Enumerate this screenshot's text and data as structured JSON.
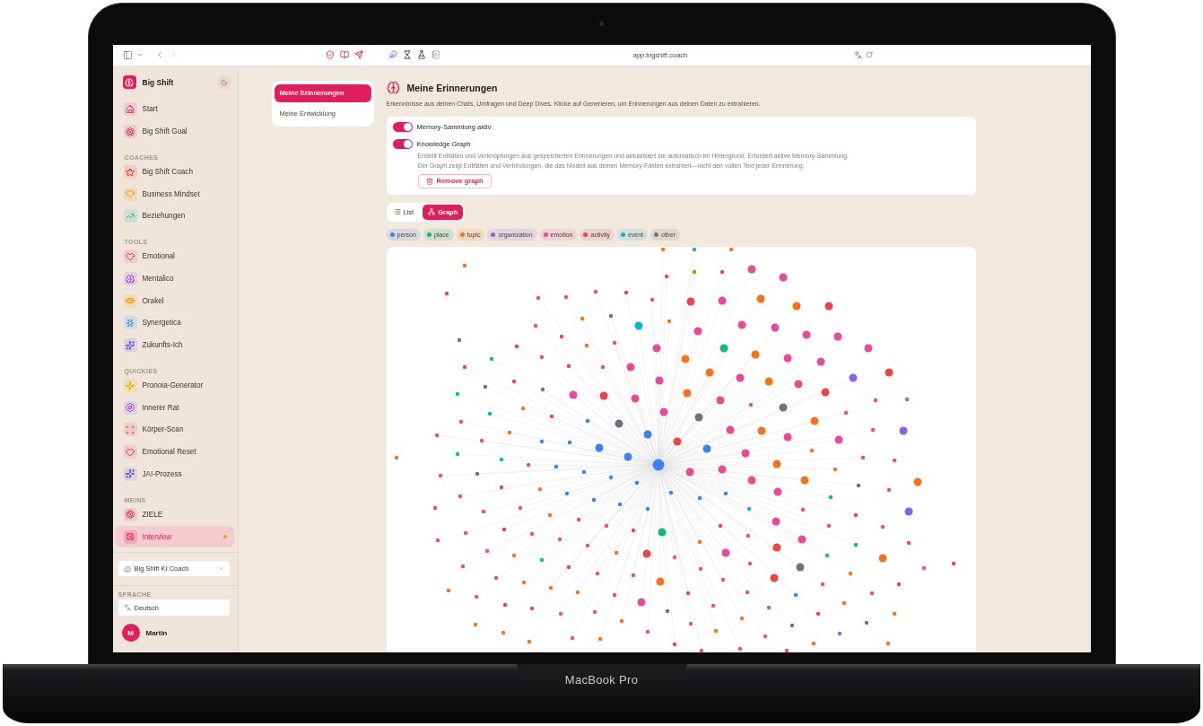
{
  "device": {
    "label": "MacBook Pro"
  },
  "browser": {
    "url": "app.bigshift.coach"
  },
  "sidebar": {
    "brand": "Big Shift",
    "main": [
      {
        "label": "Start",
        "color": "#e8457c",
        "selected": false,
        "notification": false
      },
      {
        "label": "Big Shift Goal",
        "color": "#e8457c",
        "selected": false,
        "notification": false
      }
    ],
    "sections": [
      {
        "heading": "COACHES",
        "items": [
          {
            "label": "Big Shift Coach",
            "color": "#ef4444",
            "selected": false,
            "notification": false
          },
          {
            "label": "Business Mindset",
            "color": "#f59e0b",
            "selected": false,
            "notification": false
          },
          {
            "label": "Beziehungen",
            "color": "#14b8a6",
            "selected": false,
            "notification": false
          }
        ]
      },
      {
        "heading": "TOOLS",
        "items": [
          {
            "label": "Emotional",
            "color": "#e8457c",
            "selected": false,
            "notification": false
          },
          {
            "label": "Mentalico",
            "color": "#a855f7",
            "selected": false,
            "notification": false
          },
          {
            "label": "Orakel",
            "color": "#f59e0b",
            "selected": false,
            "notification": false
          },
          {
            "label": "Synergetica",
            "color": "#60a5fa",
            "selected": false,
            "notification": false
          },
          {
            "label": "Zukunfts-Ich",
            "color": "#6366f1",
            "selected": false,
            "notification": false
          }
        ]
      },
      {
        "heading": "QUICKIES",
        "items": [
          {
            "label": "Pronoia-Generator",
            "color": "#eab308",
            "selected": false,
            "notification": false
          },
          {
            "label": "Innerer Rat",
            "color": "#a855f7",
            "selected": false,
            "notification": false
          },
          {
            "label": "Körper-Scan",
            "color": "#ef4444",
            "selected": false,
            "notification": false
          },
          {
            "label": "Emotional Reset",
            "color": "#e8457c",
            "selected": false,
            "notification": false
          },
          {
            "label": "JA!-Prozess",
            "color": "#6366f1",
            "selected": false,
            "notification": false
          }
        ]
      },
      {
        "heading": "MEINS",
        "items": [
          {
            "label": "ZIELE",
            "color": "#e8457c",
            "selected": false,
            "notification": false
          },
          {
            "label": "Interview",
            "color": "#e8457c",
            "selected": true,
            "notification": true
          }
        ]
      }
    ],
    "coach_select": {
      "value": "Big Shift KI Coach"
    },
    "language": {
      "heading": "SPRACHE",
      "value": "Deutsch"
    },
    "user": {
      "initial": "M",
      "name": "Martin"
    }
  },
  "subnav": [
    {
      "label": "Meine Erinnerungen",
      "selected": true
    },
    {
      "label": "Meine Entwicklung",
      "selected": false
    }
  ],
  "page": {
    "title": "Meine Erinnerungen",
    "subtitle": "Erkenntnisse aus deinen Chats, Umfragen und Deep Dives. Klicke auf Generieren, um Erinnerungen aus deinen Daten zu extrahieren."
  },
  "settings": {
    "toggles": [
      {
        "label": "Memory-Sammlung aktiv",
        "on": true
      },
      {
        "label": "Knowledge Graph",
        "on": true
      }
    ],
    "notes": [
      "Erstellt Entitäten und Verknüpfungen aus gespeicherten Erinnerungen und aktualisiert sie automatisch im Hintergrund. Erfordert aktive Memory-Sammlung.",
      "Der Graph zeigt Entitäten und Verbindungen, die das Modell aus deinen Memory-Fakten extrahiert—nicht den vollen Text jeder Erinnerung."
    ],
    "remove_button": "Remove graph"
  },
  "view_switch": [
    {
      "label": "List",
      "selected": false
    },
    {
      "label": "Graph",
      "selected": true
    }
  ],
  "legend": [
    {
      "label": "person",
      "color": "#3b82f6"
    },
    {
      "label": "place",
      "color": "#10b981"
    },
    {
      "label": "topic",
      "color": "#f97316"
    },
    {
      "label": "organization",
      "color": "#8b5cf6"
    },
    {
      "label": "emotion",
      "color": "#ec4899"
    },
    {
      "label": "activity",
      "color": "#ef4444"
    },
    {
      "label": "event",
      "color": "#06b6d4"
    },
    {
      "label": "other",
      "color": "#6b7280"
    }
  ],
  "graph": {
    "nodes": [
      {
        "color": "#f97316",
        "large": false,
        "central": false
      },
      {
        "color": "#06b6d4",
        "large": false,
        "central": false
      },
      {
        "color": "#f97316",
        "large": false,
        "central": false
      },
      {
        "color": "#f97316",
        "large": false,
        "central": false
      },
      {
        "color": "#ec4899",
        "large": true,
        "central": false
      },
      {
        "color": "#f97316",
        "large": false,
        "central": false
      },
      {
        "color": "#ef4444",
        "large": false,
        "central": false
      },
      {
        "color": "#ef4444",
        "large": false,
        "central": false
      },
      {
        "color": "#ec4899",
        "large": true,
        "central": false
      },
      {
        "color": "#ec4899",
        "large": false,
        "central": false
      },
      {
        "color": "#ef4444",
        "large": false,
        "central": false
      },
      {
        "color": "#ef4444",
        "large": false,
        "central": false
      },
      {
        "color": "#ec4899",
        "large": false,
        "central": false
      },
      {
        "color": "#ec4899",
        "large": false,
        "central": false
      },
      {
        "color": "#f97316",
        "large": true,
        "central": false
      },
      {
        "color": "#ec4899",
        "large": false,
        "central": false
      },
      {
        "color": "#ec4899",
        "large": true,
        "central": false
      },
      {
        "color": "#ef4444",
        "large": true,
        "central": false
      },
      {
        "color": "#f97316",
        "large": true,
        "central": false
      },
      {
        "color": "#ef4444",
        "large": true,
        "central": false
      },
      {
        "color": "#6b7280",
        "large": false,
        "central": false
      },
      {
        "color": "#f97316",
        "large": false,
        "central": false
      },
      {
        "color": "#f97316",
        "large": false,
        "central": false
      },
      {
        "color": "#ec4899",
        "large": true,
        "central": false
      },
      {
        "color": "#ec4899",
        "large": false,
        "central": false
      },
      {
        "color": "#06b6d4",
        "large": true,
        "central": false
      },
      {
        "color": "#ec4899",
        "large": true,
        "central": false
      },
      {
        "color": "#ec4899",
        "large": true,
        "central": false
      },
      {
        "color": "#ec4899",
        "large": true,
        "central": false
      },
      {
        "color": "#ef4444",
        "large": false,
        "central": false
      },
      {
        "color": "#ec4899",
        "large": true,
        "central": false
      },
      {
        "color": "#6b7280",
        "large": false,
        "central": false
      },
      {
        "color": "#ec4899",
        "large": false,
        "central": false
      },
      {
        "color": "#f97316",
        "large": false,
        "central": false
      },
      {
        "color": "#ef4444",
        "large": false,
        "central": false
      },
      {
        "color": "#ec4899",
        "large": true,
        "central": false
      },
      {
        "color": "#10b981",
        "large": true,
        "central": false
      },
      {
        "color": "#ec4899",
        "large": true,
        "central": false
      },
      {
        "color": "#f97316",
        "large": true,
        "central": false
      },
      {
        "color": "#ec4899",
        "large": false,
        "central": false
      },
      {
        "color": "#ec4899",
        "large": true,
        "central": false
      },
      {
        "color": "#06b6d4",
        "large": false,
        "central": false
      },
      {
        "color": "#f97316",
        "large": true,
        "central": false
      },
      {
        "color": "#ec4899",
        "large": true,
        "central": false
      },
      {
        "color": "#ef4444",
        "large": false,
        "central": false
      },
      {
        "color": "#ef4444",
        "large": false,
        "central": false
      },
      {
        "color": "#ec4899",
        "large": false,
        "central": false
      },
      {
        "color": "#ec4899",
        "large": true,
        "central": false
      },
      {
        "color": "#f97316",
        "large": true,
        "central": false
      },
      {
        "color": "#ef4444",
        "large": true,
        "central": false
      },
      {
        "color": "#ec4899",
        "large": true,
        "central": false
      },
      {
        "color": "#8b5cf6",
        "large": true,
        "central": false
      },
      {
        "color": "#ec4899",
        "large": true,
        "central": false
      },
      {
        "color": "#ef4444",
        "large": false,
        "central": false
      },
      {
        "color": "#f97316",
        "large": true,
        "central": false
      },
      {
        "color": "#ec4899",
        "large": true,
        "central": false
      },
      {
        "color": "#6b7280",
        "large": false,
        "central": false
      },
      {
        "color": "#6b7280",
        "large": false,
        "central": false
      },
      {
        "color": "#ef4444",
        "large": true,
        "central": false
      },
      {
        "color": "#f97316",
        "large": true,
        "central": false
      },
      {
        "color": "#06b6d4",
        "large": false,
        "central": false
      },
      {
        "color": "#ec4899",
        "large": true,
        "central": false
      },
      {
        "color": "#ef4444",
        "large": true,
        "central": false
      },
      {
        "color": "#ec4899",
        "large": true,
        "central": false
      },
      {
        "color": "#ec4899",
        "large": false,
        "central": false
      },
      {
        "color": "#ec4899",
        "large": true,
        "central": false
      },
      {
        "color": "#ec4899",
        "large": false,
        "central": false
      },
      {
        "color": "#ec4899",
        "large": false,
        "central": false
      },
      {
        "color": "#6b7280",
        "large": true,
        "central": false
      },
      {
        "color": "#f97316",
        "large": false,
        "central": false
      },
      {
        "color": "#ec4899",
        "large": true,
        "central": false
      },
      {
        "color": "#ec4899",
        "large": false,
        "central": false
      },
      {
        "color": "#06b6d4",
        "large": false,
        "central": false
      },
      {
        "color": "#ef4444",
        "large": false,
        "central": false
      },
      {
        "color": "#6b7280",
        "large": true,
        "central": false
      },
      {
        "color": "#3b82f6",
        "large": false,
        "central": false
      },
      {
        "color": "#f97316",
        "large": true,
        "central": false
      },
      {
        "color": "#ec4899",
        "large": false,
        "central": false
      },
      {
        "color": "#6b7280",
        "large": true,
        "central": false
      },
      {
        "color": "#ec4899",
        "large": true,
        "central": false
      },
      {
        "color": "#ec4899",
        "large": false,
        "central": false
      },
      {
        "color": "#f97316",
        "large": true,
        "central": false
      },
      {
        "color": "#8b5cf6",
        "large": true,
        "central": false
      },
      {
        "color": "#f97316",
        "large": false,
        "central": false
      },
      {
        "color": "#3b82f6",
        "large": true,
        "central": false
      },
      {
        "color": "#ec4899",
        "large": false,
        "central": false
      },
      {
        "color": "#ec4899",
        "large": true,
        "central": false
      },
      {
        "color": "#ec4899",
        "large": true,
        "central": false
      },
      {
        "color": "#ec4899",
        "large": false,
        "central": false
      },
      {
        "color": "#3b82f6",
        "large": false,
        "central": false
      },
      {
        "color": "#ef4444",
        "large": true,
        "central": false
      },
      {
        "color": "#3b82f6",
        "large": false,
        "central": false
      },
      {
        "color": "#3b82f6",
        "large": true,
        "central": false
      },
      {
        "color": "#3b82f6",
        "large": true,
        "central": false
      },
      {
        "color": "#f97316",
        "large": false,
        "central": false
      },
      {
        "color": "#ec4899",
        "large": true,
        "central": false
      },
      {
        "color": "#06b6d4",
        "large": false,
        "central": false
      },
      {
        "color": "#3b82f6",
        "large": true,
        "central": false
      },
      {
        "color": "#f97316",
        "large": false,
        "central": false
      },
      {
        "color": "#ec4899",
        "large": false,
        "central": false
      },
      {
        "color": "#06b6d4",
        "large": false,
        "central": false
      },
      {
        "color": "#ec4899",
        "large": false,
        "central": false
      },
      {
        "color": "#f97316",
        "large": true,
        "central": false
      },
      {
        "color": "#ec4899",
        "large": false,
        "central": false
      },
      {
        "color": "#3b82f6",
        "large": true,
        "central": true
      },
      {
        "color": "#3b82f6",
        "large": false,
        "central": false
      },
      {
        "color": "#ec4899",
        "large": true,
        "central": false
      },
      {
        "color": "#f97316",
        "large": false,
        "central": false
      },
      {
        "color": "#3b82f6",
        "large": false,
        "central": false
      },
      {
        "color": "#ec4899",
        "large": true,
        "central": false
      },
      {
        "color": "#6b7280",
        "large": false,
        "central": false
      },
      {
        "color": "#ec4899",
        "large": false,
        "central": false
      },
      {
        "color": "#3b82f6",
        "large": false,
        "central": false
      },
      {
        "color": "#ec4899",
        "large": true,
        "central": false
      },
      {
        "color": "#f97316",
        "large": true,
        "central": false
      },
      {
        "color": "#f97316",
        "large": true,
        "central": false
      },
      {
        "color": "#3b82f6",
        "large": false,
        "central": false
      },
      {
        "color": "#6b7280",
        "large": false,
        "central": false
      },
      {
        "color": "#ef4444",
        "large": false,
        "central": false
      },
      {
        "color": "#f97316",
        "large": false,
        "central": false
      },
      {
        "color": "#ec4899",
        "large": false,
        "central": false
      },
      {
        "color": "#ec4899",
        "large": true,
        "central": false
      },
      {
        "color": "#3b82f6",
        "large": false,
        "central": false
      },
      {
        "color": "#3b82f6",
        "large": false,
        "central": false
      },
      {
        "color": "#3b82f6",
        "large": false,
        "central": false
      },
      {
        "color": "#ec4899",
        "large": false,
        "central": false
      },
      {
        "color": "#10b981",
        "large": false,
        "central": false
      },
      {
        "color": "#3b82f6",
        "large": false,
        "central": false
      },
      {
        "color": "#3b82f6",
        "large": false,
        "central": false
      },
      {
        "color": "#3b82f6",
        "large": false,
        "central": false
      },
      {
        "color": "#ec4899",
        "large": false,
        "central": false
      },
      {
        "color": "#ec4899",
        "large": false,
        "central": false
      },
      {
        "color": "#3b82f6",
        "large": false,
        "central": false
      },
      {
        "color": "#06b6d4",
        "large": false,
        "central": false
      },
      {
        "color": "#ec4899",
        "large": false,
        "central": false
      },
      {
        "color": "#ec4899",
        "large": false,
        "central": false
      },
      {
        "color": "#8b5cf6",
        "large": true,
        "central": false
      },
      {
        "color": "#f97316",
        "large": false,
        "central": false
      },
      {
        "color": "#ef4444",
        "large": false,
        "central": false
      },
      {
        "color": "#ec4899",
        "large": false,
        "central": false
      },
      {
        "color": "#ec4899",
        "large": true,
        "central": false
      },
      {
        "color": "#ec4899",
        "large": false,
        "central": false
      },
      {
        "color": "#ef4444",
        "large": false,
        "central": false
      },
      {
        "color": "#ec4899",
        "large": false,
        "central": false
      },
      {
        "color": "#ec4899",
        "large": false,
        "central": false
      },
      {
        "color": "#ef4444",
        "large": false,
        "central": false
      },
      {
        "color": "#ef4444",
        "large": false,
        "central": false
      },
      {
        "color": "#10b981",
        "large": true,
        "central": false
      },
      {
        "color": "#ec4899",
        "large": false,
        "central": false
      },
      {
        "color": "#ec4899",
        "large": false,
        "central": false
      },
      {
        "color": "#ec4899",
        "large": false,
        "central": false
      },
      {
        "color": "#ec4899",
        "large": false,
        "central": false
      },
      {
        "color": "#ec4899",
        "large": true,
        "central": false
      },
      {
        "color": "#ec4899",
        "large": false,
        "central": false
      },
      {
        "color": "#f97316",
        "large": false,
        "central": false
      },
      {
        "color": "#ef4444",
        "large": false,
        "central": false
      },
      {
        "color": "#10b981",
        "large": false,
        "central": false
      },
      {
        "color": "#ec4899",
        "large": false,
        "central": false
      },
      {
        "color": "#ef4444",
        "large": true,
        "central": false
      },
      {
        "color": "#ec4899",
        "large": false,
        "central": false
      },
      {
        "color": "#f97316",
        "large": false,
        "central": false
      },
      {
        "color": "#ec4899",
        "large": true,
        "central": false
      },
      {
        "color": "#ef4444",
        "large": true,
        "central": false
      },
      {
        "color": "#f97316",
        "large": false,
        "central": false
      },
      {
        "color": "#06b6d4",
        "large": false,
        "central": false
      },
      {
        "color": "#ec4899",
        "large": false,
        "central": false
      },
      {
        "color": "#f97316",
        "large": true,
        "central": false
      },
      {
        "color": "#06b6d4",
        "large": false,
        "central": false
      },
      {
        "color": "#ec4899",
        "large": false,
        "central": false
      },
      {
        "color": "#ef4444",
        "large": false,
        "central": false
      },
      {
        "color": "#ec4899",
        "large": false,
        "central": false
      },
      {
        "color": "#ef4444",
        "large": false,
        "central": false
      },
      {
        "color": "#6b7280",
        "large": true,
        "central": false
      },
      {
        "color": "#ec4899",
        "large": false,
        "central": false
      },
      {
        "color": "#ec4899",
        "large": false,
        "central": false
      },
      {
        "color": "#ec4899",
        "large": false,
        "central": false
      },
      {
        "color": "#f97316",
        "large": false,
        "central": false
      },
      {
        "color": "#ec4899",
        "large": false,
        "central": false
      },
      {
        "color": "#ec4899",
        "large": false,
        "central": false
      },
      {
        "color": "#ef4444",
        "large": true,
        "central": false
      },
      {
        "color": "#ec4899",
        "large": false,
        "central": false
      },
      {
        "color": "#f97316",
        "large": true,
        "central": false
      },
      {
        "color": "#f97316",
        "large": false,
        "central": false
      },
      {
        "color": "#ec4899",
        "large": false,
        "central": false
      },
      {
        "color": "#ef4444",
        "large": false,
        "central": false
      },
      {
        "color": "#f97316",
        "large": false,
        "central": false
      },
      {
        "color": "#f97316",
        "large": false,
        "central": false
      },
      {
        "color": "#f97316",
        "large": false,
        "central": false
      },
      {
        "color": "#ec4899",
        "large": false,
        "central": false
      },
      {
        "color": "#ef4444",
        "large": false,
        "central": false
      },
      {
        "color": "#ec4899",
        "large": false,
        "central": false
      },
      {
        "color": "#ec4899",
        "large": false,
        "central": false
      },
      {
        "color": "#3b82f6",
        "large": false,
        "central": false
      },
      {
        "color": "#ec4899",
        "large": false,
        "central": false
      },
      {
        "color": "#ec4899",
        "large": true,
        "central": false
      },
      {
        "color": "#f97316",
        "large": false,
        "central": false
      },
      {
        "color": "#ef4444",
        "large": false,
        "central": false
      },
      {
        "color": "#ec4899",
        "large": false,
        "central": false
      },
      {
        "color": "#ec4899",
        "large": false,
        "central": false
      },
      {
        "color": "#ef4444",
        "large": false,
        "central": false
      },
      {
        "color": "#6b7280",
        "large": false,
        "central": false
      },
      {
        "color": "#ec4899",
        "large": false,
        "central": false
      },
      {
        "color": "#ec4899",
        "large": false,
        "central": false
      },
      {
        "color": "#ef4444",
        "large": false,
        "central": false
      },
      {
        "color": "#f97316",
        "large": false,
        "central": false
      },
      {
        "color": "#f97316",
        "large": false,
        "central": false
      },
      {
        "color": "#f97316",
        "large": false,
        "central": false
      },
      {
        "color": "#6b7280",
        "large": false,
        "central": false
      },
      {
        "color": "#ec4899",
        "large": false,
        "central": false
      },
      {
        "color": "#f97316",
        "large": false,
        "central": false
      },
      {
        "color": "#6b7280",
        "large": false,
        "central": false
      },
      {
        "color": "#f97316",
        "large": false,
        "central": false
      },
      {
        "color": "#ec4899",
        "large": false,
        "central": false
      },
      {
        "color": "#f97316",
        "large": false,
        "central": false
      },
      {
        "color": "#8b5cf6",
        "large": false,
        "central": false
      },
      {
        "color": "#ec4899",
        "large": false,
        "central": false
      },
      {
        "color": "#ec4899",
        "large": false,
        "central": false
      },
      {
        "color": "#f97316",
        "large": false,
        "central": false
      },
      {
        "color": "#f97316",
        "large": false,
        "central": false
      },
      {
        "color": "#f97316",
        "large": false,
        "central": false
      },
      {
        "color": "#f97316",
        "large": false,
        "central": false
      },
      {
        "color": "#ef4444",
        "large": false,
        "central": false
      },
      {
        "color": "#ec4899",
        "large": false,
        "central": false
      },
      {
        "color": "#ec4899",
        "large": false,
        "central": false
      },
      {
        "color": "#ec4899",
        "large": false,
        "central": false
      }
    ]
  }
}
